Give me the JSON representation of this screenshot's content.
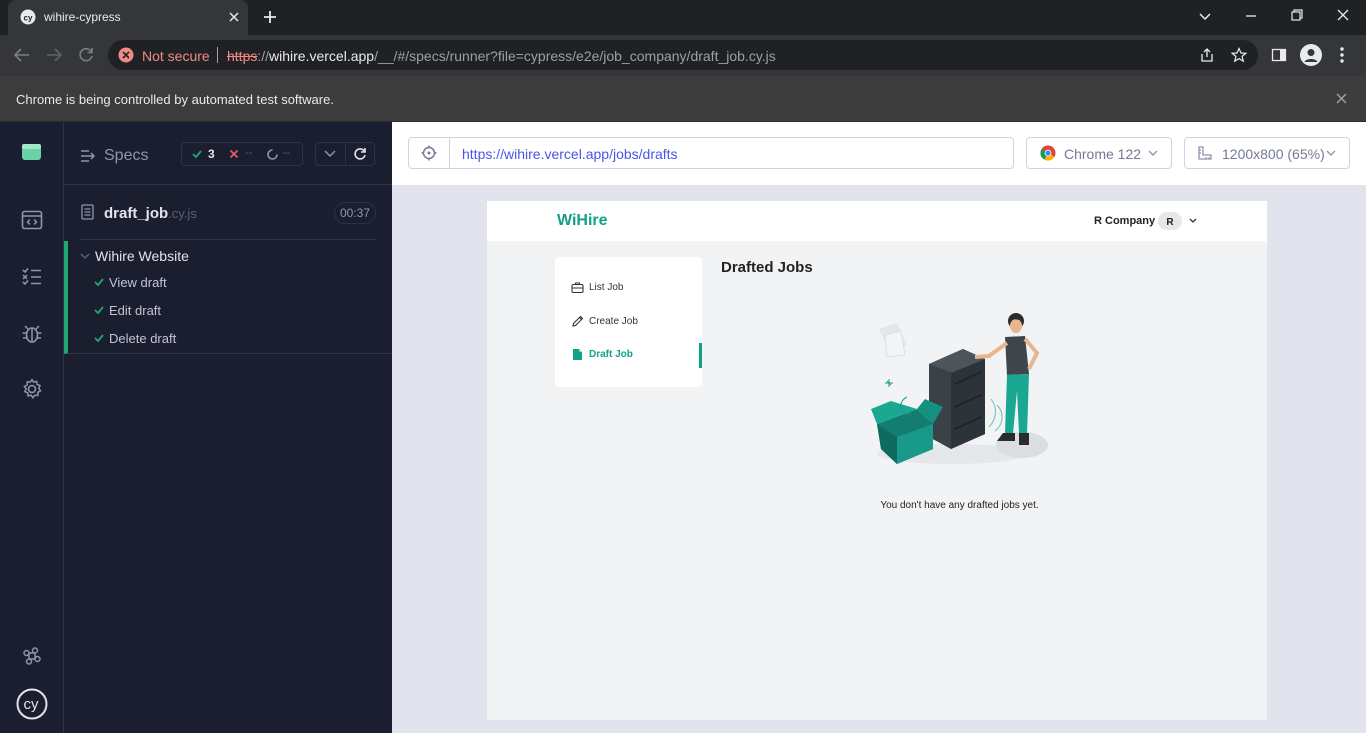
{
  "browser": {
    "tab_title": "wihire-cypress",
    "not_secure_label": "Not secure",
    "url_scheme": "https",
    "url_host": "wihire.vercel.app",
    "url_path": "/__/#/specs/runner?file=cypress/e2e/job_company/draft_job.cy.js",
    "infobar_message": "Chrome is being controlled by automated test software."
  },
  "reporter": {
    "specs_label": "Specs",
    "passed_count": "3",
    "failed_count": "--",
    "pending_count": "--",
    "spec_name": "draft_job",
    "spec_ext": ".cy.js",
    "duration": "00:37",
    "suite_title": "Wihire Website",
    "tests": [
      {
        "label": "View draft",
        "state": "passed"
      },
      {
        "label": "Edit draft",
        "state": "passed"
      },
      {
        "label": "Delete draft",
        "state": "passed"
      }
    ]
  },
  "aut": {
    "url": "https://wihire.vercel.app/jobs/drafts",
    "browser_label": "Chrome 122",
    "viewport_label": "1200x800 (65%)"
  },
  "app": {
    "logo_text": "WiHire",
    "company_name": "R Company",
    "avatar_letter": "R",
    "menu": [
      {
        "label": "List Job",
        "icon": "briefcase-icon"
      },
      {
        "label": "Create Job",
        "icon": "pencil-icon"
      },
      {
        "label": "Draft Job",
        "icon": "document-icon"
      }
    ],
    "page_title": "Drafted Jobs",
    "empty_message": "You don't have any drafted jobs yet."
  },
  "colors": {
    "accent_teal": "#13a089",
    "cypress_pass": "#1fa971",
    "cypress_fail": "#e45770",
    "link_blue": "#4956e3"
  }
}
